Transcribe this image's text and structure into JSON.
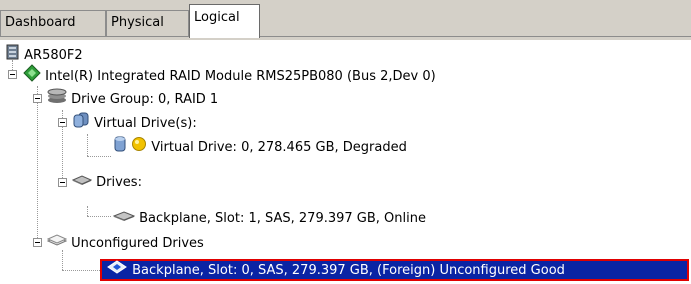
{
  "tabs": [
    {
      "label": "Dashboard"
    },
    {
      "label": "Physical"
    },
    {
      "label": "Logical",
      "active": true
    }
  ],
  "tree": {
    "root": "AR580F2",
    "controller": "Intel(R) Integrated RAID Module RMS25PB080 (Bus 2,Dev 0)",
    "drive_group": "Drive Group: 0, RAID  1",
    "virtual_drives_label": "Virtual Drive(s):",
    "virtual_drive": "Virtual Drive: 0, 278.465 GB, Degraded",
    "drives_label": "Drives:",
    "drive": "Backplane, Slot: 1, SAS, 279.397 GB, Online",
    "unconfigured_label": "Unconfigured Drives",
    "unconfigured_drive": "Backplane, Slot: 0, SAS, 279.397 GB, (Foreign) Unconfigured Good"
  },
  "colors": {
    "selection_bg": "#0a24a4",
    "selection_outline": "#e00000",
    "degraded_status": "#f2c200",
    "tab_bg": "#d4d0c8"
  }
}
